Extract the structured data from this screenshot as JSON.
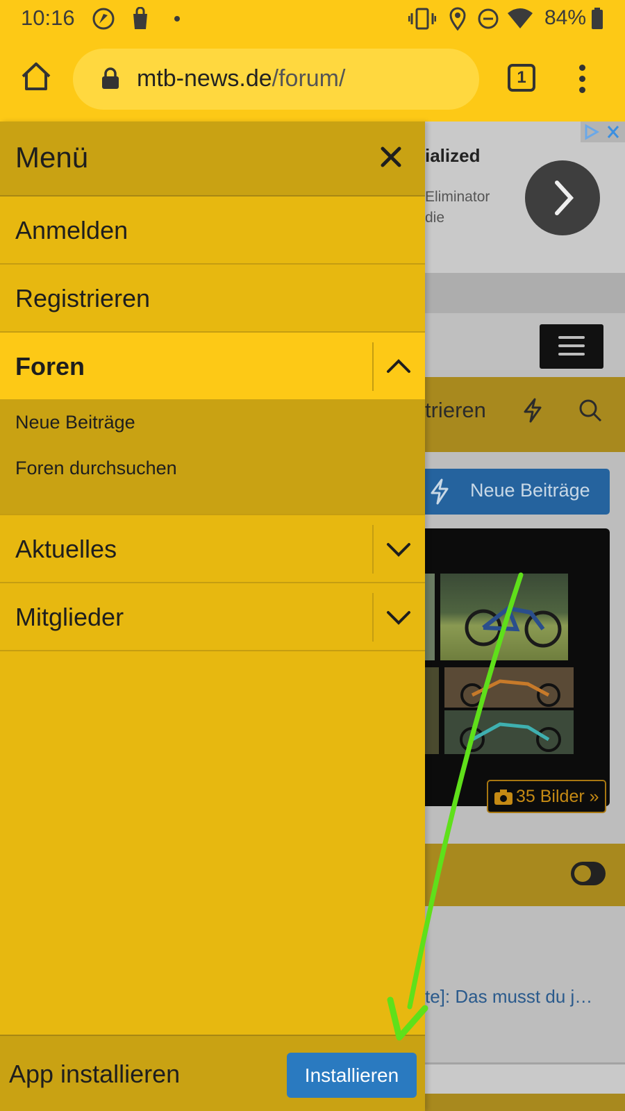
{
  "status_bar": {
    "time": "10:16",
    "battery": "84%"
  },
  "browser": {
    "url_host": "mtb-news.de",
    "url_path": "/forum/",
    "tab_count": "1"
  },
  "background_page": {
    "ad_title": "ialized",
    "ad_text": "Eliminator\ndie",
    "nav_text": "trieren",
    "new_posts_button": "Neue Beiträge",
    "pictures_button": "35 Bilder »",
    "article_link": "te]: Das musst du j…"
  },
  "drawer": {
    "title": "Menü",
    "items": [
      {
        "label": "Anmelden"
      },
      {
        "label": "Registrieren"
      },
      {
        "label": "Foren",
        "expanded": true
      },
      {
        "label": "Aktuelles"
      },
      {
        "label": "Mitglieder"
      }
    ],
    "subitems": [
      "Neue Beiträge",
      "Foren durchsuchen"
    ],
    "footer_label": "App installieren",
    "install_button": "Installieren"
  },
  "colors": {
    "brand_yellow": "#fdc916",
    "button_blue": "#2a7ac0",
    "annotation_arrow": "#5fe01a"
  }
}
